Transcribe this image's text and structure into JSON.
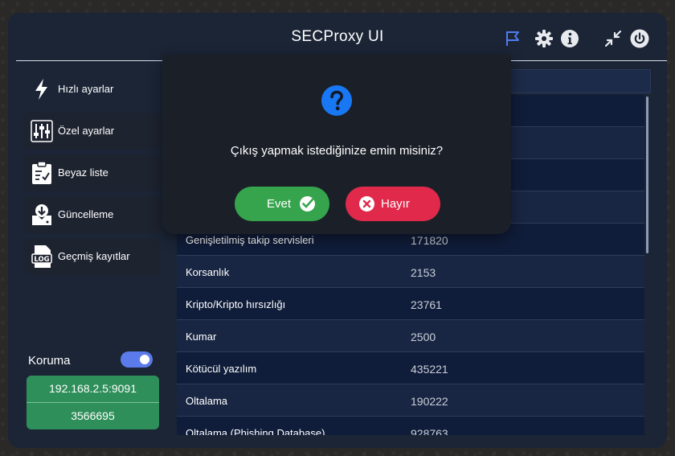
{
  "app": {
    "title": "SECProxy UI"
  },
  "titlebar_icons": [
    "flag-icon",
    "gear-icon",
    "info-icon",
    "minimize-icon",
    "power-icon"
  ],
  "sidebar": {
    "items": [
      {
        "label": "Hızlı ayarlar",
        "icon": "lightning-icon",
        "active": true
      },
      {
        "label": "Özel ayarlar",
        "icon": "sliders-icon",
        "active": false
      },
      {
        "label": "Beyaz liste",
        "icon": "clipboard-check-icon",
        "active": false
      },
      {
        "label": "Güncelleme",
        "icon": "download-icon",
        "active": false
      },
      {
        "label": "Geçmiş kayıtlar",
        "icon": "log-file-icon",
        "active": false
      }
    ]
  },
  "protection": {
    "label": "Koruma",
    "enabled": true,
    "address": "192.168.2.5:9091",
    "count": "3566695"
  },
  "table": {
    "rows": [
      {
        "category": "",
        "count": ""
      },
      {
        "category": "",
        "count": ""
      },
      {
        "category": "",
        "count": ""
      },
      {
        "category": "",
        "count": ""
      },
      {
        "category": "Genişletilmiş takip servisleri",
        "count": "171820"
      },
      {
        "category": "Korsanlık",
        "count": "2153"
      },
      {
        "category": "Kripto/Kripto hırsızlığı",
        "count": "23761"
      },
      {
        "category": "Kumar",
        "count": "2500"
      },
      {
        "category": "Kötücül yazılım",
        "count": "435221"
      },
      {
        "category": "Oltalama",
        "count": "190222"
      },
      {
        "category": "Oltalama (Phishing Database)",
        "count": "928763"
      }
    ]
  },
  "dialog": {
    "icon": "question-icon",
    "message": "Çıkış yapmak istediğinize emin misiniz?",
    "yes_label": "Evet",
    "no_label": "Hayır"
  },
  "colors": {
    "window_bg": "#1b2536",
    "accent_green": "#35a44c",
    "accent_red": "#e12a4b",
    "question_blue": "#1877f2",
    "toggle_blue": "#5b7bea",
    "info_green": "#2f8f5a"
  }
}
